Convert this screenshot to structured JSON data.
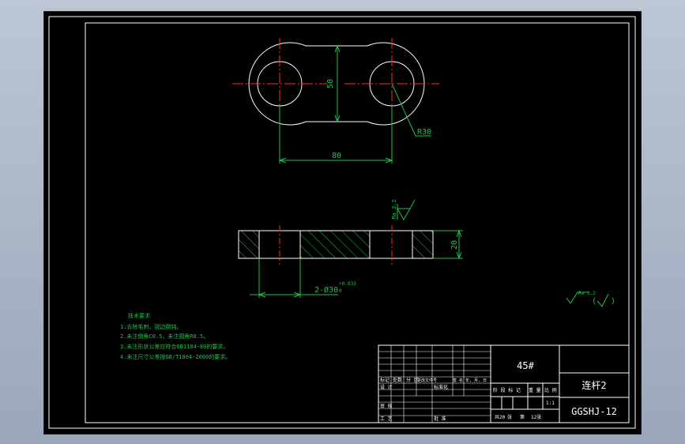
{
  "dimensions": {
    "height": "50",
    "radius": "R30",
    "center_distance": "80",
    "thickness": "20",
    "roughness_top": "Ra 3.2",
    "holes": "2-Ø30",
    "holes_tolerance": "+0.033",
    "holes_tolerance_lower": "0"
  },
  "roughness_note": {
    "value": "Ra 3.2",
    "paren_open": "(",
    "paren_close": ")"
  },
  "tech_requirements": {
    "title": "技术要求",
    "items": [
      "1.去除毛刺，锐边倒钝。",
      "2.未注倒角C0.5，未注圆角R0.5。",
      "3.未注形状公差应符合GB1184-80的要求。",
      "4.未注尺寸公差按GB/T1804-2000的要求。"
    ]
  },
  "title_block": {
    "material": "45#",
    "part_name": "连杆2",
    "drawing_no": "GGSHJ-12",
    "hdr_mark": "标记",
    "hdr_count": "处数",
    "hdr_zone": "分 区",
    "hdr_doc": "更改文件号",
    "hdr_sign": "签 名",
    "hdr_date": "年, 月, 日",
    "design": "设 计",
    "standardize": "标准化",
    "stage_mark": "阶 段 标 记",
    "weight": "重 量",
    "scale_label": "比 例",
    "scale": "1:1",
    "review": "审 核",
    "process": "工 艺",
    "approve": "批 准",
    "sheets_total": "共20",
    "sheets_label": "张",
    "sheet_no": "第",
    "sheet_no_label": "12张"
  }
}
